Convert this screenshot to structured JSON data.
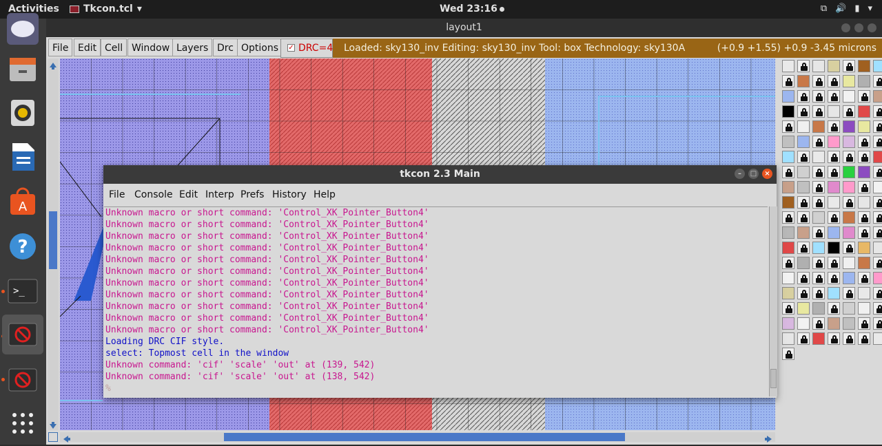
{
  "topbar": {
    "activities": "Activities",
    "app_name": "Tkcon.tcl",
    "clock": "Wed 23:16"
  },
  "dock": {
    "items": [
      {
        "name": "ubuntu-app-icon"
      },
      {
        "name": "files-icon"
      },
      {
        "name": "rhythmbox-icon"
      },
      {
        "name": "writer-icon"
      },
      {
        "name": "software-center-icon"
      },
      {
        "name": "help-icon"
      },
      {
        "name": "terminal-icon"
      },
      {
        "name": "tkcon-app-icon"
      },
      {
        "name": "magic-app-icon"
      },
      {
        "name": "show-apps-icon"
      }
    ]
  },
  "layout_window": {
    "title": "layout1",
    "menu": [
      "File",
      "Edit",
      "Cell",
      "Window",
      "Layers",
      "Drc",
      "Options"
    ],
    "drc_label": "DRC=4",
    "status_left": "Loaded: sky130_inv  Editing: sky130_inv  Tool: box   Technology: sky130A",
    "status_right": "(+0.9 +1.55) +0.9 -3.45 microns"
  },
  "tkcon": {
    "title": "tkcon 2.3 Main",
    "menu": [
      "File",
      "Console",
      "Edit",
      "Interp",
      "Prefs",
      "History",
      "Help"
    ],
    "lines": [
      {
        "text": "Unknown macro or short command: 'Control_XK_Pointer_Button4'",
        "kind": "error"
      },
      {
        "text": "Unknown macro or short command: 'Control_XK_Pointer_Button4'",
        "kind": "error"
      },
      {
        "text": "Unknown macro or short command: 'Control_XK_Pointer_Button4'",
        "kind": "error"
      },
      {
        "text": "Unknown macro or short command: 'Control_XK_Pointer_Button4'",
        "kind": "error"
      },
      {
        "text": "Unknown macro or short command: 'Control_XK_Pointer_Button4'",
        "kind": "error"
      },
      {
        "text": "Unknown macro or short command: 'Control_XK_Pointer_Button4'",
        "kind": "error"
      },
      {
        "text": "Unknown macro or short command: 'Control_XK_Pointer_Button4'",
        "kind": "error"
      },
      {
        "text": "Unknown macro or short command: 'Control_XK_Pointer_Button4'",
        "kind": "error"
      },
      {
        "text": "Unknown macro or short command: 'Control_XK_Pointer_Button4'",
        "kind": "error"
      },
      {
        "text": "Unknown macro or short command: 'Control_XK_Pointer_Button4'",
        "kind": "error"
      },
      {
        "text": "Unknown macro or short command: 'Control_XK_Pointer_Button4'",
        "kind": "error"
      },
      {
        "text": "Loading DRC CIF style.",
        "kind": "info"
      },
      {
        "text": "select: Topmost cell in the window",
        "kind": "info"
      },
      {
        "text": "Unknown command: 'cif' 'scale' 'out' at (139, 542)",
        "kind": "error"
      },
      {
        "text": "Unknown command: 'cif' 'scale' 'out' at (138, 542)",
        "kind": "error"
      },
      {
        "text": "%",
        "kind": "prompt"
      }
    ]
  },
  "colors": {
    "error_text": "#c8168f",
    "info_text": "#1010c8",
    "prompt_text": "#c0a0a0",
    "status_bg": "#996515",
    "drc_text": "#cc0000"
  }
}
